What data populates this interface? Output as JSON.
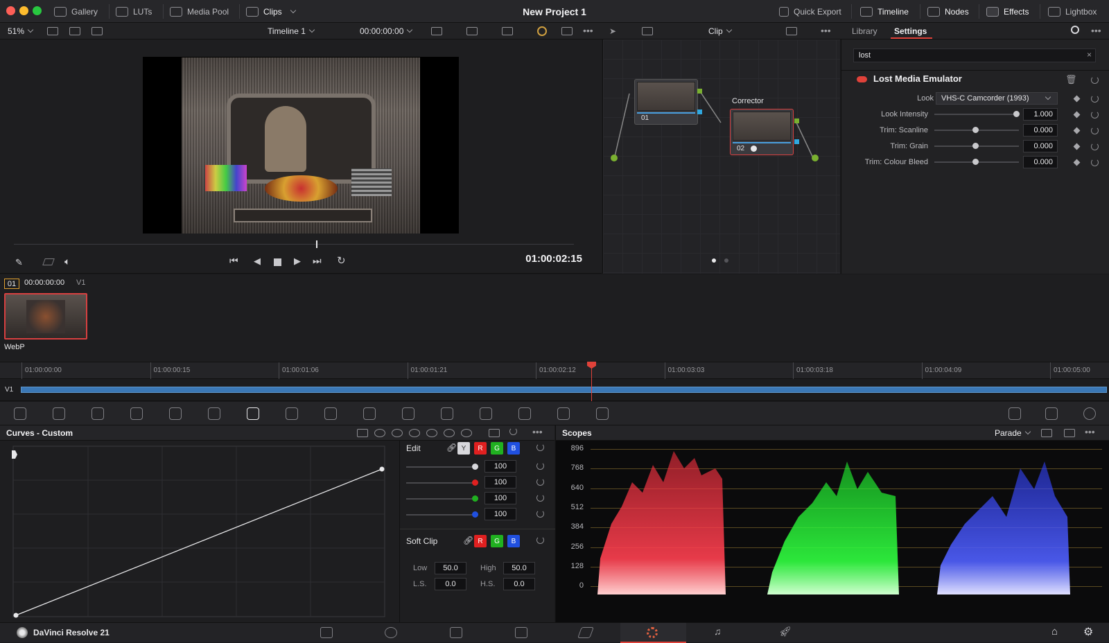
{
  "window": {
    "title": "New Project 1"
  },
  "topbar": {
    "gallery": "Gallery",
    "luts": "LUTs",
    "media_pool": "Media Pool",
    "clips": "Clips",
    "quick_export": "Quick Export",
    "timeline": "Timeline",
    "nodes": "Nodes",
    "effects": "Effects",
    "lightbox": "Lightbox"
  },
  "toolbar": {
    "zoom": "51%",
    "timeline_name": "Timeline 1",
    "timecode": "00:00:00:00",
    "node_mode": "Clip"
  },
  "viewer": {
    "current_timecode": "01:00:02:15",
    "scrub_position": 0.54
  },
  "node_graph": {
    "nodes": [
      {
        "number": "01",
        "label": ""
      },
      {
        "number": "02",
        "label": "Corrector"
      }
    ]
  },
  "settings": {
    "tabs": [
      "Library",
      "Settings"
    ],
    "active_tab": "Settings",
    "search_value": "lost",
    "effect_name": "Lost Media Emulator",
    "look_label": "Look",
    "look_value": "VHS-C Camcorder (1993)",
    "params": [
      {
        "label": "Look Intensity",
        "value": "1.000",
        "level": 1.0
      },
      {
        "label": "Trim: Scanline",
        "value": "0.000",
        "level": 0.5
      },
      {
        "label": "Trim: Grain",
        "value": "0.000",
        "level": 0.5
      },
      {
        "label": "Trim: Colour Bleed",
        "value": "0.000",
        "level": 0.5
      }
    ]
  },
  "clips": {
    "clip_number": "01",
    "clip_timecode": "00:00:00:00",
    "track": "V1",
    "clip_name": "WebP"
  },
  "timeline": {
    "ticks": [
      "01:00:00:00",
      "01:00:00:15",
      "01:00:01:06",
      "01:00:01:21",
      "01:00:02:12",
      "01:00:03:03",
      "01:00:03:18",
      "01:00:04:09",
      "01:00:05:00"
    ],
    "track_label": "V1",
    "playhead_timecode": "01:00:02:15"
  },
  "curves": {
    "title": "Curves - Custom"
  },
  "edit": {
    "label": "Edit",
    "channels": [
      "Y",
      "R",
      "G",
      "B"
    ],
    "values": [
      "100",
      "100",
      "100",
      "100"
    ],
    "soft_clip_label": "Soft Clip",
    "low_label": "Low",
    "low_value": "50.0",
    "high_label": "High",
    "high_value": "50.0",
    "ls_label": "L.S.",
    "ls_value": "0.0",
    "hs_label": "H.S.",
    "hs_value": "0.0"
  },
  "scopes": {
    "title": "Scopes",
    "mode": "Parade",
    "scale": [
      "896",
      "768",
      "640",
      "512",
      "384",
      "256",
      "128",
      "0"
    ]
  },
  "app": {
    "name": "DaVinci Resolve 21"
  },
  "colors": {
    "accent_red": "#e0423a",
    "accent_orange": "#f0a030",
    "node_border": "#d84040"
  }
}
